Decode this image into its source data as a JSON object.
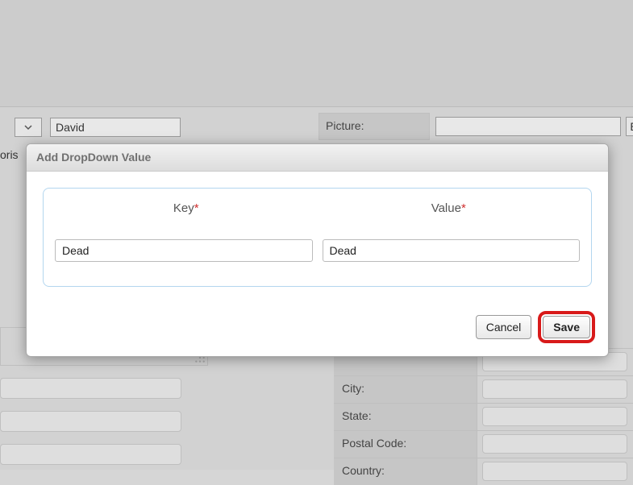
{
  "background": {
    "partial_row_text": "oris",
    "name_value": "David",
    "picture_label": "Picture:",
    "picture_browse_partial": "E",
    "right_labels": {
      "blank": "",
      "city": "City:",
      "state": "State:",
      "postal": "Postal Code:",
      "country": "Country:"
    }
  },
  "modal": {
    "title": "Add DropDown Value",
    "key_label": "Key",
    "value_label": "Value",
    "required_mark": "*",
    "key_value": "Dead",
    "value_value": "Dead",
    "cancel_label": "Cancel",
    "save_label": "Save"
  }
}
